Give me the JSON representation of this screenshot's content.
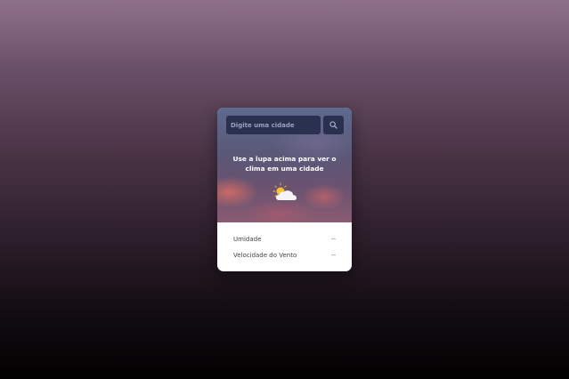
{
  "search": {
    "placeholder": "Digite uma cidade",
    "icon": "search-icon"
  },
  "message": "Use a lupa acima para ver o clima em uma cidade",
  "weather_icon": "partly-cloudy-icon",
  "details": [
    {
      "label": "Umidade",
      "value": "--"
    },
    {
      "label": "Velocidade do Vento",
      "value": "--"
    }
  ]
}
